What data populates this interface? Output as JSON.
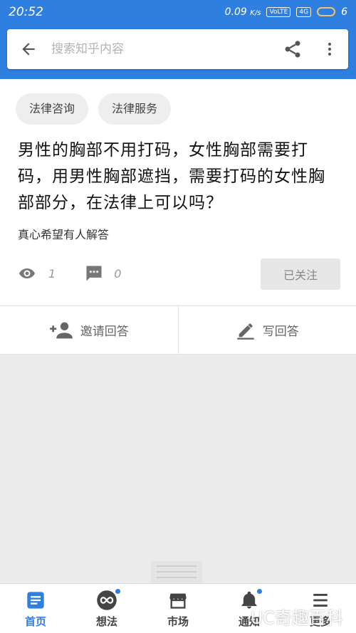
{
  "status_bar": {
    "time": "20:52",
    "speed": "0.09",
    "speed_unit": "K/s",
    "volte": "VoLTE",
    "net": "4G",
    "battery": "6"
  },
  "search": {
    "placeholder": "搜索知乎内容"
  },
  "question": {
    "tags": [
      "法律咨询",
      "法律服务"
    ],
    "title": "男性的胸部不用打码，女性胸部需要打码，用男性胸部遮挡，需要打码的女性胸部部分，在法律上可以吗？",
    "detail": "真心希望有人解答",
    "views": "1",
    "comments": "0",
    "follow_label": "已关注"
  },
  "actions": {
    "invite_label": "邀请回答",
    "write_label": "写回答"
  },
  "nav": {
    "items": [
      {
        "label": "首页",
        "icon": "home-icon"
      },
      {
        "label": "想法",
        "icon": "ideas-icon"
      },
      {
        "label": "市场",
        "icon": "market-icon"
      },
      {
        "label": "通知",
        "icon": "bell-icon"
      },
      {
        "label": "更多",
        "icon": "menu-icon"
      }
    ]
  },
  "watermark": "UC奇趣百科",
  "colors": {
    "accent": "#2f7fe0",
    "chip_bg": "#eeeeee",
    "page_bg": "#ececec"
  }
}
